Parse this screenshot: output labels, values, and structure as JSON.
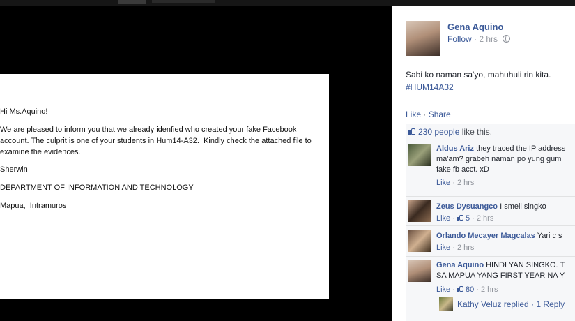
{
  "letter": {
    "greeting": "Hi Ms.Aquino!",
    "body_line1": "We are pleased to inform you that we already idenfied who created your fake Facebook",
    "body_line2": "account. The culprit is one of your students in Hum14-A32.  Kindly check the attached file to",
    "body_line3": "examine the evidences.",
    "signature": "Sherwin",
    "department": "DEPARTMENT OF INFORMATION AND TECHNOLOGY",
    "location": "Mapua,  Intramuros"
  },
  "post": {
    "author": "Gena Aquino",
    "follow": "Follow",
    "time": "2 hrs",
    "text": "Sabi ko naman sa'yo, mahuhuli rin kita.",
    "hashtag": "#HUM14A32",
    "like_label": "Like",
    "share_label": "Share",
    "likes_count": "230 people",
    "likes_suffix": "like this."
  },
  "comments": [
    {
      "name": "Aldus Ariz",
      "text1": "they traced the IP address",
      "text2": "ma'am? grabeh naman po yung gum",
      "text3": "fake fb acct. xD",
      "like": "Like",
      "time": "2 hrs",
      "likes": ""
    },
    {
      "name": "Zeus Dysuangco",
      "text1": "I smell singko",
      "like": "Like",
      "likes": "5",
      "time": "2 hrs"
    },
    {
      "name": "Orlando Mecayer Magcalas",
      "text1": "Yari c s",
      "like": "Like",
      "time": "2 hrs",
      "likes": ""
    },
    {
      "name": "Gena Aquino",
      "text1": "HINDI YAN SINGKO. T",
      "text2": "SA MAPUA YANG FIRST YEAR NA Y",
      "like": "Like",
      "likes": "80",
      "time": "2 hrs"
    }
  ],
  "reply": {
    "text": "Kathy Veluz replied · 1 Reply"
  }
}
